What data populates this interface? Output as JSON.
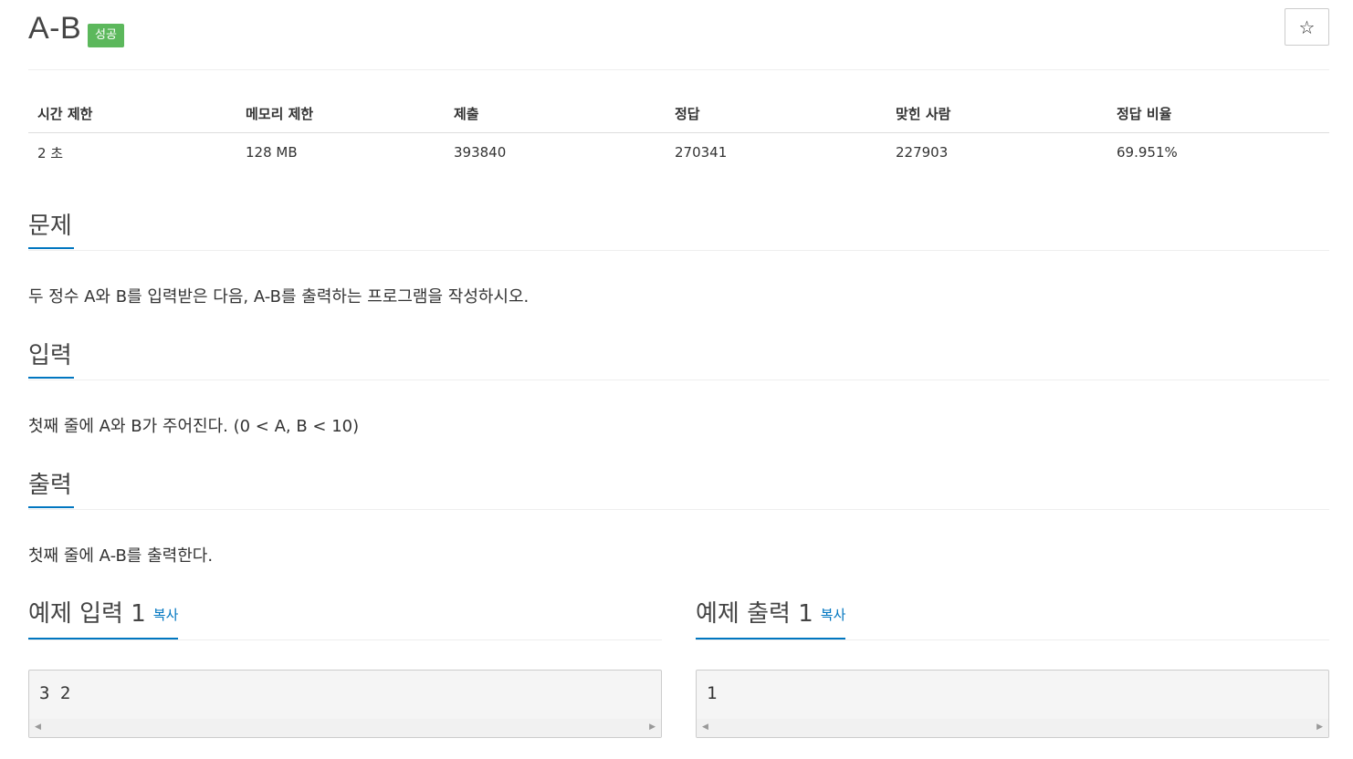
{
  "problem": {
    "title": "A-B",
    "status_badge": "성공",
    "star_icon": "☆"
  },
  "info_table": {
    "headers": [
      "시간 제한",
      "메모리 제한",
      "제출",
      "정답",
      "맞힌 사람",
      "정답 비율"
    ],
    "values": [
      "2 초",
      "128 MB",
      "393840",
      "270341",
      "227903",
      "69.951%"
    ]
  },
  "sections": {
    "description": {
      "title": "문제",
      "text": "두 정수 A와 B를 입력받은 다음, A-B를 출력하는 프로그램을 작성하시오."
    },
    "input": {
      "title": "입력",
      "text": "첫째 줄에 A와 B가 주어진다. (0 < A, B < 10)"
    },
    "output": {
      "title": "출력",
      "text": "첫째 줄에 A-B를 출력한다."
    }
  },
  "samples": {
    "input": {
      "title": "예제 입력 1",
      "copy_label": "복사",
      "data": "3 2"
    },
    "output": {
      "title": "예제 출력 1",
      "copy_label": "복사",
      "data": "1"
    }
  },
  "colors": {
    "accent": "#0076c0",
    "success": "#5cb85c"
  }
}
